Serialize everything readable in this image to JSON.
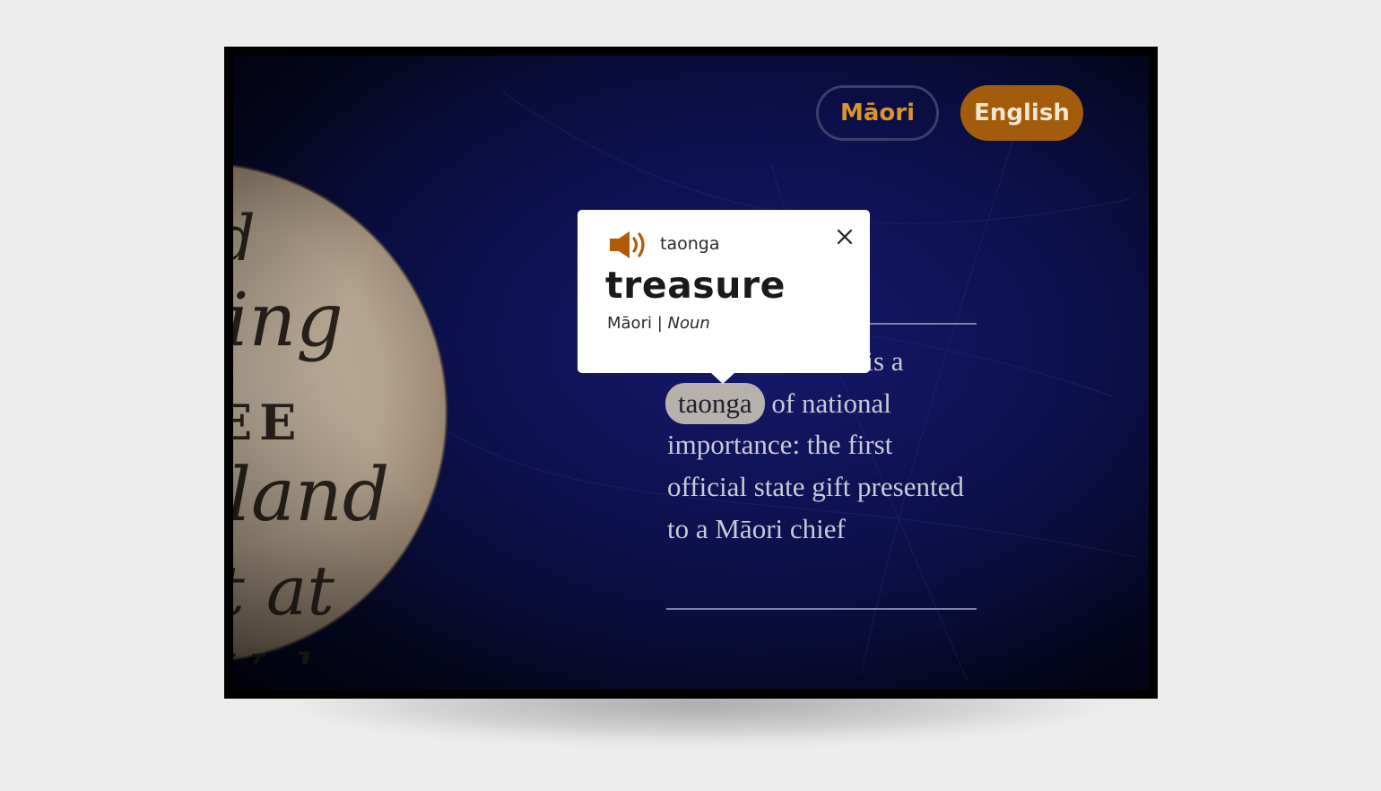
{
  "language_toggle": {
    "maori_label": "Māori",
    "english_label": "English",
    "active": "English"
  },
  "quote": {
    "line1_visible": "l is a",
    "highlighted_word": "taonga",
    "after_highlight": " of national",
    "rest": "importance: the first official state gift presented to a Māori chief"
  },
  "popup": {
    "speaker_icon": "speaker-icon",
    "word": "taonga",
    "translation": "treasure",
    "language": "Māori",
    "separator": " | ",
    "part_of_speech": "Noun",
    "close_icon": "close-icon"
  },
  "colors": {
    "accent_orange": "#a35c0c",
    "maori_text": "#d9952a",
    "background_navy": "#0d1150",
    "highlight": "#b6b1ab"
  }
}
